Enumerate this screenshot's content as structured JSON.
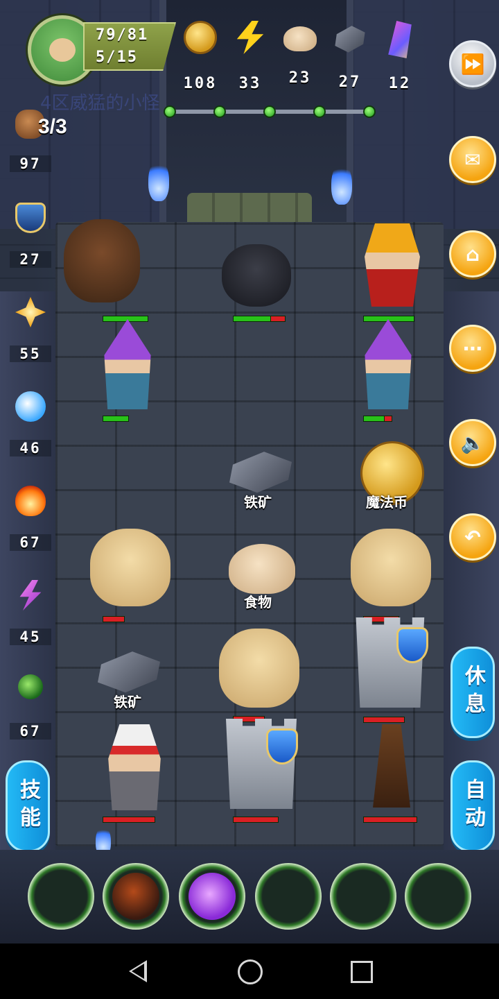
{
  "player": {
    "hp": "79/81",
    "floor": "5/15",
    "faded_name": "4区威猛的小怪"
  },
  "resources": [
    {
      "icon": "gold-coin-icon",
      "value": "108"
    },
    {
      "icon": "energy-bolt-icon",
      "value": "33"
    },
    {
      "icon": "food-bun-icon",
      "value": "23"
    },
    {
      "icon": "iron-ore-icon",
      "value": "27"
    },
    {
      "icon": "magic-crystal-icon",
      "value": "12"
    }
  ],
  "progress": {
    "dots": 5,
    "filled": 5
  },
  "keys": "3/3",
  "stats": [
    {
      "icon": "fist-icon",
      "value": "97"
    },
    {
      "icon": "shield-icon",
      "value": "27"
    },
    {
      "icon": "holy-light-icon",
      "value": "55"
    },
    {
      "icon": "water-wave-icon",
      "value": "46"
    },
    {
      "icon": "fire-icon",
      "value": "67"
    },
    {
      "icon": "lightning-icon",
      "value": "45"
    },
    {
      "icon": "poison-icon",
      "value": "67"
    }
  ],
  "board_labels": {
    "iron1": "铁矿",
    "magic_coin": "魔法币",
    "food": "食物",
    "iron2": "铁矿"
  },
  "buttons": {
    "skill": "技能",
    "rest": "休息",
    "auto": "自动"
  },
  "side_buttons": [
    "fast-forward-icon",
    "mail-icon",
    "home-icon",
    "chat-icon",
    "sound-icon",
    "return-icon"
  ]
}
